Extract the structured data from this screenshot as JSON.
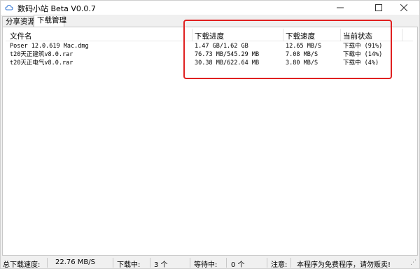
{
  "window": {
    "title": "数码小站 Beta V0.0.7",
    "icon": "cloud-icon"
  },
  "tabs": [
    {
      "label": "分享资源",
      "active": false
    },
    {
      "label": "下载管理",
      "active": true
    }
  ],
  "list": {
    "columns": [
      "文件名",
      "下载进度",
      "下载速度",
      "当前状态"
    ],
    "rows": [
      {
        "name": "Poser 12.0.619 Mac.dmg",
        "progress": "1.47 GB/1.62 GB",
        "speed": "12.65 MB/S",
        "state": "下载中 (91%)"
      },
      {
        "name": "t20天正建筑v8.0.rar",
        "progress": "76.73 MB/545.29 MB",
        "speed": "7.08 MB/S",
        "state": "下载中 (14%)"
      },
      {
        "name": "t20天正电气v8.0.rar",
        "progress": "30.38 MB/622.64 MB",
        "speed": "3.80 MB/S",
        "state": "下载中 (4%)"
      }
    ]
  },
  "statusbar": {
    "total_speed_label": "总下载速度:",
    "total_speed_value": "22.76 MB/S",
    "downloading_label": "下载中:",
    "downloading_value": "3 个",
    "waiting_label": "等待中:",
    "waiting_value": "0 个",
    "notice_label": "注意:",
    "notice_text": "本程序为免费程序，请勿贩卖!"
  },
  "colors": {
    "highlight": "#e02020",
    "window_bg": "#f0f0f0",
    "panel_bg": "#ffffff"
  }
}
